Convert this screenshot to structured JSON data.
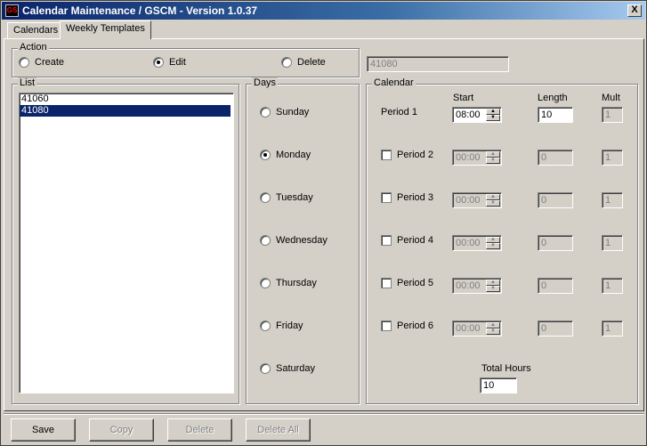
{
  "window": {
    "title": "Calendar Maintenance / GSCM - Version 1.0.37",
    "close_glyph": "X",
    "icon_text": "GS"
  },
  "tabs": [
    {
      "label": "Calendars"
    },
    {
      "label": "Weekly Templates"
    }
  ],
  "action": {
    "legend": "Action",
    "options": [
      {
        "label": "Create",
        "selected": false
      },
      {
        "label": "Edit",
        "selected": true
      },
      {
        "label": "Delete",
        "selected": false
      }
    ]
  },
  "template_name": {
    "value": "41080"
  },
  "list": {
    "legend": "List",
    "items": [
      {
        "label": "41060",
        "selected": false
      },
      {
        "label": "41080",
        "selected": true
      }
    ]
  },
  "days": {
    "legend": "Days",
    "options": [
      {
        "label": "Sunday",
        "selected": false
      },
      {
        "label": "Monday",
        "selected": true
      },
      {
        "label": "Tuesday",
        "selected": false
      },
      {
        "label": "Wednesday",
        "selected": false
      },
      {
        "label": "Thursday",
        "selected": false
      },
      {
        "label": "Friday",
        "selected": false
      },
      {
        "label": "Saturday",
        "selected": false
      }
    ]
  },
  "calendar": {
    "legend": "Calendar",
    "headers": {
      "start": "Start",
      "length": "Length",
      "mult": "Mult"
    },
    "periods": [
      {
        "label": "Period 1",
        "start": "08:00",
        "length": "10",
        "mult": "1",
        "enabled": true,
        "checkbox": false
      },
      {
        "label": "Period 2",
        "start": "00:00",
        "length": "0",
        "mult": "1",
        "enabled": false,
        "checkbox": true
      },
      {
        "label": "Period 3",
        "start": "00:00",
        "length": "0",
        "mult": "1",
        "enabled": false,
        "checkbox": true
      },
      {
        "label": "Period 4",
        "start": "00:00",
        "length": "0",
        "mult": "1",
        "enabled": false,
        "checkbox": true
      },
      {
        "label": "Period 5",
        "start": "00:00",
        "length": "0",
        "mult": "1",
        "enabled": false,
        "checkbox": true
      },
      {
        "label": "Period 6",
        "start": "00:00",
        "length": "0",
        "mult": "1",
        "enabled": false,
        "checkbox": true
      }
    ],
    "total_hours_label": "Total Hours",
    "total_hours": "10"
  },
  "buttons": [
    {
      "label": "Save",
      "enabled": true
    },
    {
      "label": "Copy",
      "enabled": false
    },
    {
      "label": "Delete",
      "enabled": false
    },
    {
      "label": "Delete All",
      "enabled": false
    }
  ]
}
